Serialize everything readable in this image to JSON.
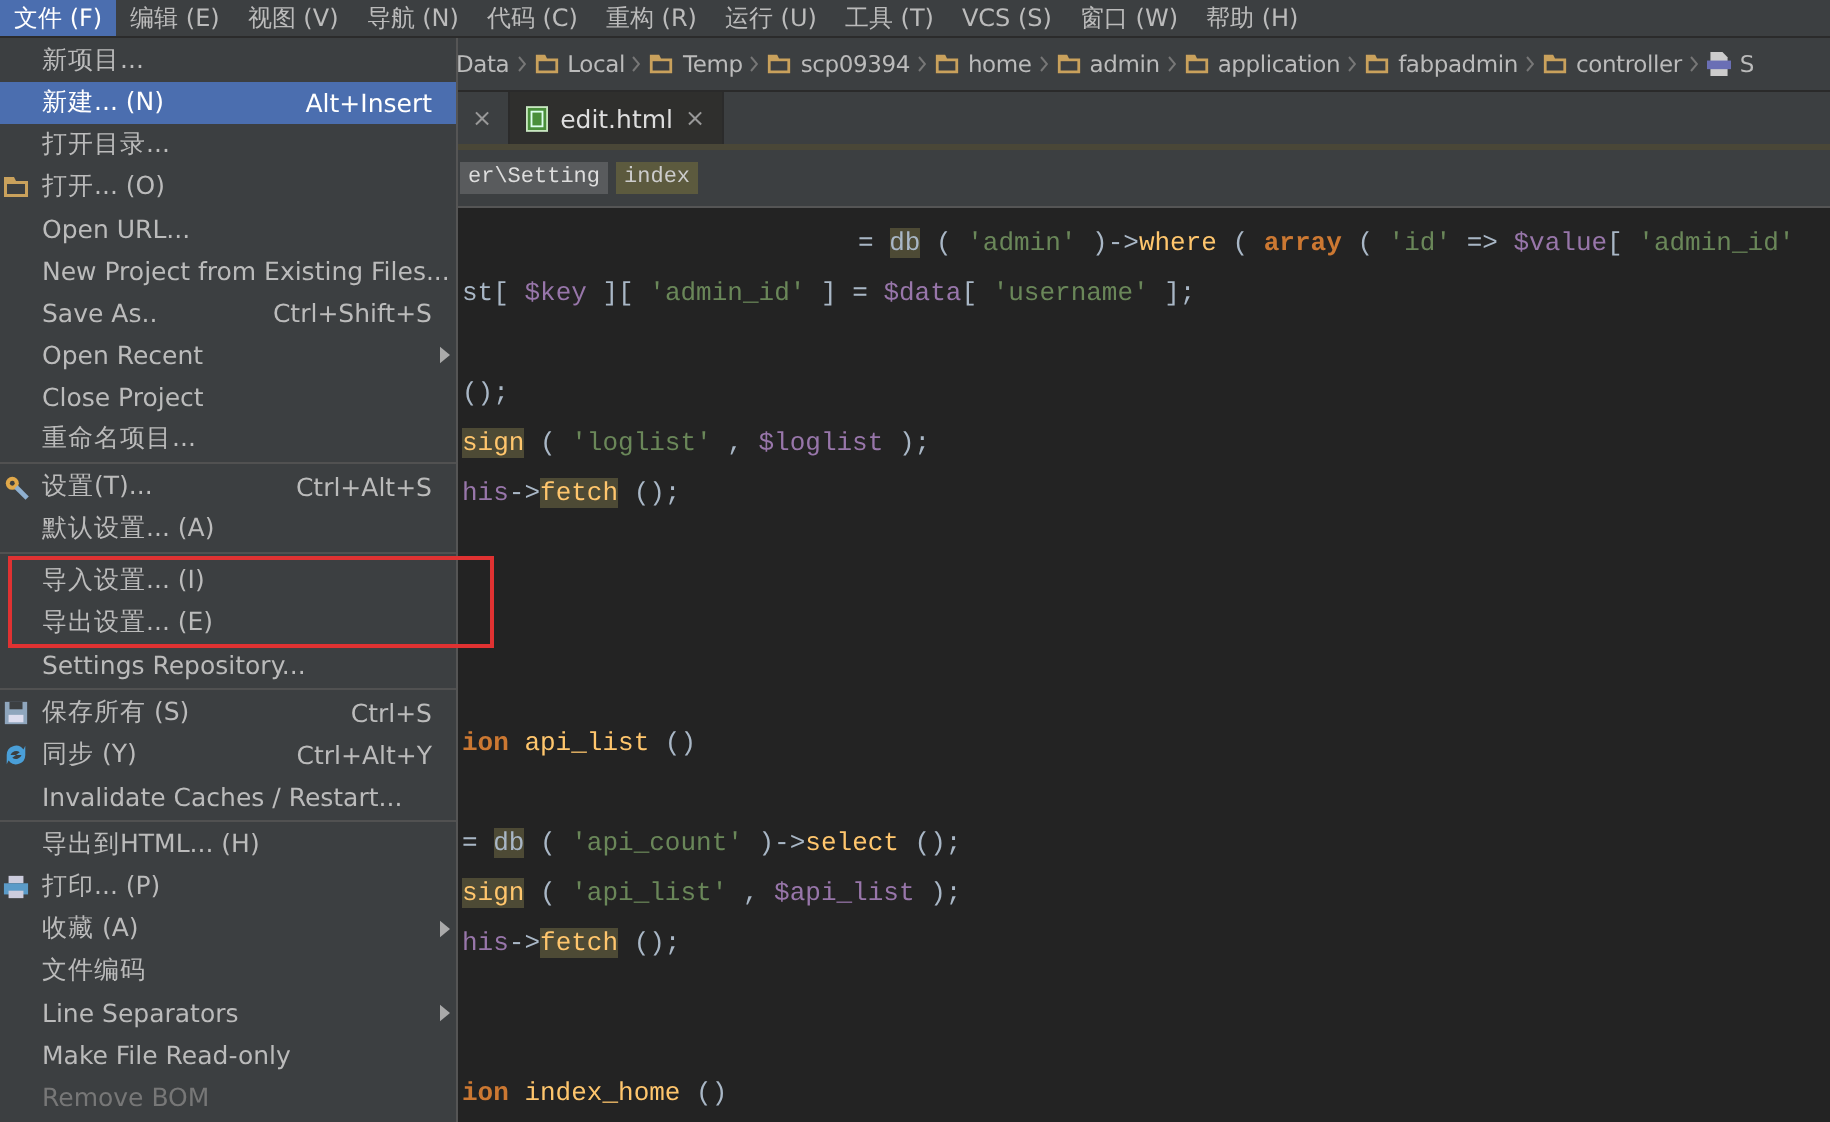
{
  "menubar": [
    {
      "label": "文件 (F)",
      "selected": true
    },
    {
      "label": "编辑 (E)",
      "selected": false
    },
    {
      "label": "视图 (V)",
      "selected": false
    },
    {
      "label": "导航 (N)",
      "selected": false
    },
    {
      "label": "代码 (C)",
      "selected": false
    },
    {
      "label": "重构 (R)",
      "selected": false
    },
    {
      "label": "运行 (U)",
      "selected": false
    },
    {
      "label": "工具 (T)",
      "selected": false
    },
    {
      "label": "VCS (S)",
      "selected": false
    },
    {
      "label": "窗口 (W)",
      "selected": false
    },
    {
      "label": "帮助 (H)",
      "selected": false
    }
  ],
  "navbar": [
    {
      "label": "Data",
      "kind": "plain"
    },
    {
      "label": "Local",
      "kind": "folder"
    },
    {
      "label": "Temp",
      "kind": "folder"
    },
    {
      "label": "scp09394",
      "kind": "folder"
    },
    {
      "label": "home",
      "kind": "folder"
    },
    {
      "label": "admin",
      "kind": "folder"
    },
    {
      "label": "application",
      "kind": "folder"
    },
    {
      "label": "fabpadmin",
      "kind": "folder"
    },
    {
      "label": "controller",
      "kind": "folder"
    },
    {
      "label": "S",
      "kind": "file"
    }
  ],
  "tabs": [
    {
      "close": "×",
      "selected": false
    },
    {
      "label": "edit.html",
      "close": "×",
      "selected": true
    }
  ],
  "code_path": [
    {
      "label": "er\\Setting",
      "selected": false
    },
    {
      "label": "index",
      "selected": true
    }
  ],
  "code_lines": [
    {
      "kind": "indented",
      "segments": [
        {
          "text": "= ",
          "kind": "plain"
        },
        {
          "text": "db",
          "kind": "plain",
          "highlighted": true
        },
        {
          "text": " ( ",
          "kind": "plain"
        },
        {
          "text": "'admin'",
          "kind": "string"
        },
        {
          "text": " )->",
          "kind": "plain"
        },
        {
          "text": "where",
          "kind": "method"
        },
        {
          "text": " ( ",
          "kind": "plain"
        },
        {
          "text": "array",
          "kind": "keyword"
        },
        {
          "text": " ( ",
          "kind": "plain"
        },
        {
          "text": "'id'",
          "kind": "string"
        },
        {
          "text": " => ",
          "kind": "plain"
        },
        {
          "text": "$value",
          "kind": "var"
        },
        {
          "text": "[ ",
          "kind": "plain"
        },
        {
          "text": "'admin_id'",
          "kind": "string"
        }
      ]
    },
    {
      "kind": "normal",
      "segments": [
        {
          "text": "st",
          "kind": "plain"
        },
        {
          "text": "[ ",
          "kind": "plain"
        },
        {
          "text": "$key",
          "kind": "var"
        },
        {
          "text": " ][ ",
          "kind": "plain"
        },
        {
          "text": "'admin_id'",
          "kind": "string"
        },
        {
          "text": " ] = ",
          "kind": "plain"
        },
        {
          "text": "$data",
          "kind": "var"
        },
        {
          "text": "[ ",
          "kind": "plain"
        },
        {
          "text": "'username'",
          "kind": "string"
        },
        {
          "text": " ];",
          "kind": "plain"
        }
      ]
    },
    {
      "kind": "blank"
    },
    {
      "kind": "normal",
      "segments": [
        {
          "text": "();",
          "kind": "plain"
        }
      ]
    },
    {
      "kind": "normal",
      "segments": [
        {
          "text": "sign",
          "kind": "method",
          "highlighted": true
        },
        {
          "text": " ( ",
          "kind": "plain"
        },
        {
          "text": "'loglist'",
          "kind": "string"
        },
        {
          "text": " , ",
          "kind": "plain"
        },
        {
          "text": "$loglist",
          "kind": "var"
        },
        {
          "text": " );",
          "kind": "plain"
        }
      ]
    },
    {
      "kind": "normal",
      "segments": [
        {
          "text": "his",
          "kind": "var"
        },
        {
          "text": "->",
          "kind": "plain"
        },
        {
          "text": "fetch",
          "kind": "method",
          "highlighted": true
        },
        {
          "text": " ();",
          "kind": "plain"
        }
      ]
    },
    {
      "kind": "blank"
    },
    {
      "kind": "blank"
    },
    {
      "kind": "blank"
    },
    {
      "kind": "blank"
    },
    {
      "kind": "normal",
      "segments": [
        {
          "text": "ion",
          "kind": "keyword"
        },
        {
          "text": " api_list",
          "kind": "method"
        },
        {
          "text": " ()",
          "kind": "plain"
        }
      ]
    },
    {
      "kind": "blank"
    },
    {
      "kind": "normal",
      "segments": [
        {
          "text": "= ",
          "kind": "plain"
        },
        {
          "text": "db",
          "kind": "plain",
          "highlighted": true
        },
        {
          "text": " ( ",
          "kind": "plain"
        },
        {
          "text": "'api_count'",
          "kind": "string"
        },
        {
          "text": " )->",
          "kind": "plain"
        },
        {
          "text": "select",
          "kind": "method"
        },
        {
          "text": " ();",
          "kind": "plain"
        }
      ]
    },
    {
      "kind": "normal",
      "segments": [
        {
          "text": "sign",
          "kind": "method",
          "highlighted": true
        },
        {
          "text": " ( ",
          "kind": "plain"
        },
        {
          "text": "'api_list'",
          "kind": "string"
        },
        {
          "text": " , ",
          "kind": "plain"
        },
        {
          "text": "$api_list",
          "kind": "var"
        },
        {
          "text": " );",
          "kind": "plain"
        }
      ]
    },
    {
      "kind": "normal",
      "segments": [
        {
          "text": "his",
          "kind": "var"
        },
        {
          "text": "->",
          "kind": "plain"
        },
        {
          "text": "fetch",
          "kind": "method",
          "highlighted": true
        },
        {
          "text": " ();",
          "kind": "plain"
        }
      ]
    },
    {
      "kind": "blank"
    },
    {
      "kind": "blank"
    },
    {
      "kind": "normal",
      "segments": [
        {
          "text": "ion",
          "kind": "keyword"
        },
        {
          "text": " index_home",
          "kind": "method"
        },
        {
          "text": " ()",
          "kind": "plain"
        }
      ]
    }
  ],
  "file_menu": [
    {
      "items": [
        {
          "label": "新项目...",
          "selected": false
        },
        {
          "label": "新建... (N)",
          "shortcut": "Alt+Insert",
          "selected": true
        },
        {
          "label": "打开目录...",
          "selected": false
        },
        {
          "label": "打开... (O)",
          "kind": "folder",
          "selected": false
        },
        {
          "label": "Open URL...",
          "selected": false
        },
        {
          "label": "New Project from Existing Files...",
          "selected": false
        },
        {
          "label": "Save As..",
          "shortcut": "Ctrl+Shift+S",
          "selected": false
        },
        {
          "label": "Open Recent",
          "submenu": true,
          "selected": false
        },
        {
          "label": "Close Project",
          "selected": false
        },
        {
          "label": "重命名项目...",
          "selected": false
        }
      ]
    },
    {
      "items": [
        {
          "label": "设置(T)...",
          "shortcut": "Ctrl+Alt+S",
          "kind": "gear",
          "selected": false
        },
        {
          "label": "默认设置... (A)",
          "selected": false
        }
      ]
    },
    {
      "framed": [
        {
          "label": "导入设置... (I)",
          "selected": false
        },
        {
          "label": "导出设置... (E)",
          "selected": false
        }
      ],
      "items": [
        {
          "label": "Settings Repository...",
          "selected": false
        }
      ]
    },
    {
      "items": [
        {
          "label": "保存所有 (S)",
          "shortcut": "Ctrl+S",
          "kind": "save",
          "selected": false
        },
        {
          "label": "同步 (Y)",
          "shortcut": "Ctrl+Alt+Y",
          "kind": "sync",
          "selected": false
        },
        {
          "label": "Invalidate Caches / Restart...",
          "selected": false
        }
      ]
    },
    {
      "items": [
        {
          "label": "导出到HTML... (H)",
          "selected": false
        },
        {
          "label": "打印... (P)",
          "kind": "printer",
          "selected": false
        },
        {
          "label": "收藏 (A)",
          "submenu": true,
          "selected": false
        },
        {
          "label": "文件编码",
          "selected": false
        },
        {
          "label": "Line Separators",
          "submenu": true,
          "selected": false
        },
        {
          "label": "Make File Read-only",
          "selected": false
        },
        {
          "label": "Remove BOM",
          "disabled": true,
          "selected": false
        }
      ]
    }
  ]
}
